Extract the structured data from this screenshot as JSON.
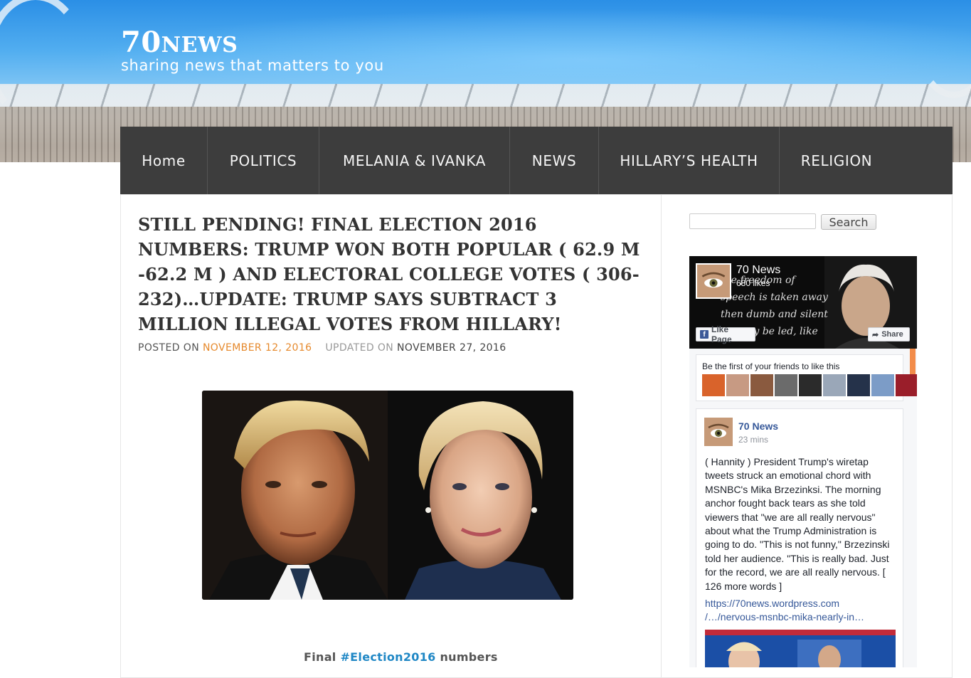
{
  "site": {
    "title_prefix": "70",
    "title_rest": "NEWS",
    "tagline": "sharing news that matters to you"
  },
  "nav": {
    "items": [
      {
        "label": "Home"
      },
      {
        "label": "POLITICS"
      },
      {
        "label": "MELANIA & IVANKA"
      },
      {
        "label": "NEWS"
      },
      {
        "label": "HILLARY’S HEALTH"
      },
      {
        "label": "RELIGION"
      }
    ]
  },
  "article": {
    "title": "Still Pending! Final Election 2016 Numbers: Trump Won Both Popular ( 62.9 M -62.2 M ) And Electoral College Votes ( 306-232)…UPDATE: Trump Says Subtract 3 Million Illegal Votes From Hillary!",
    "posted_label": "POSTED ON",
    "posted_date": "NOVEMBER 12, 2016",
    "updated_label": "UPDATED ON",
    "updated_date": "NOVEMBER 27, 2016",
    "caption_before": "Final ",
    "caption_hashtag": "#Election2016",
    "caption_after": " numbers"
  },
  "sidebar": {
    "search_placeholder": "",
    "search_button": "Search",
    "facebook": {
      "page_name": "70 News",
      "likes": "680 likes",
      "cover_quote": "the freedom of\nspeech is taken away\nthen dumb and silent\nwe may be led, like",
      "like_button": "Like Page",
      "share_button": "Share",
      "friends_text": "Be the first of your friends to like this",
      "post": {
        "author": "70 News",
        "time": "23 mins",
        "text": "( Hannity ) President Trump's wiretap tweets struck an emotional chord with MSNBC's Mika Brzezinksi. The morning anchor fought back tears as she told viewers that \"we are all really nervous\" about what the Trump Administration is going to do. \"This is not funny,\" Brzezinski told her audience. \"This is really bad. Just for the record, we are all really nervous. [ 126 more words ]",
        "link_line1": "https://70news.wordpress.com",
        "link_line2": "/…/nervous-msnbc-mika-nearly-in…"
      }
    }
  },
  "colors": {
    "nav_bg": "#3d3d3d",
    "accent_orange": "#e6892c",
    "hashtag_blue": "#1f87c5",
    "fb_blue": "#365899"
  }
}
